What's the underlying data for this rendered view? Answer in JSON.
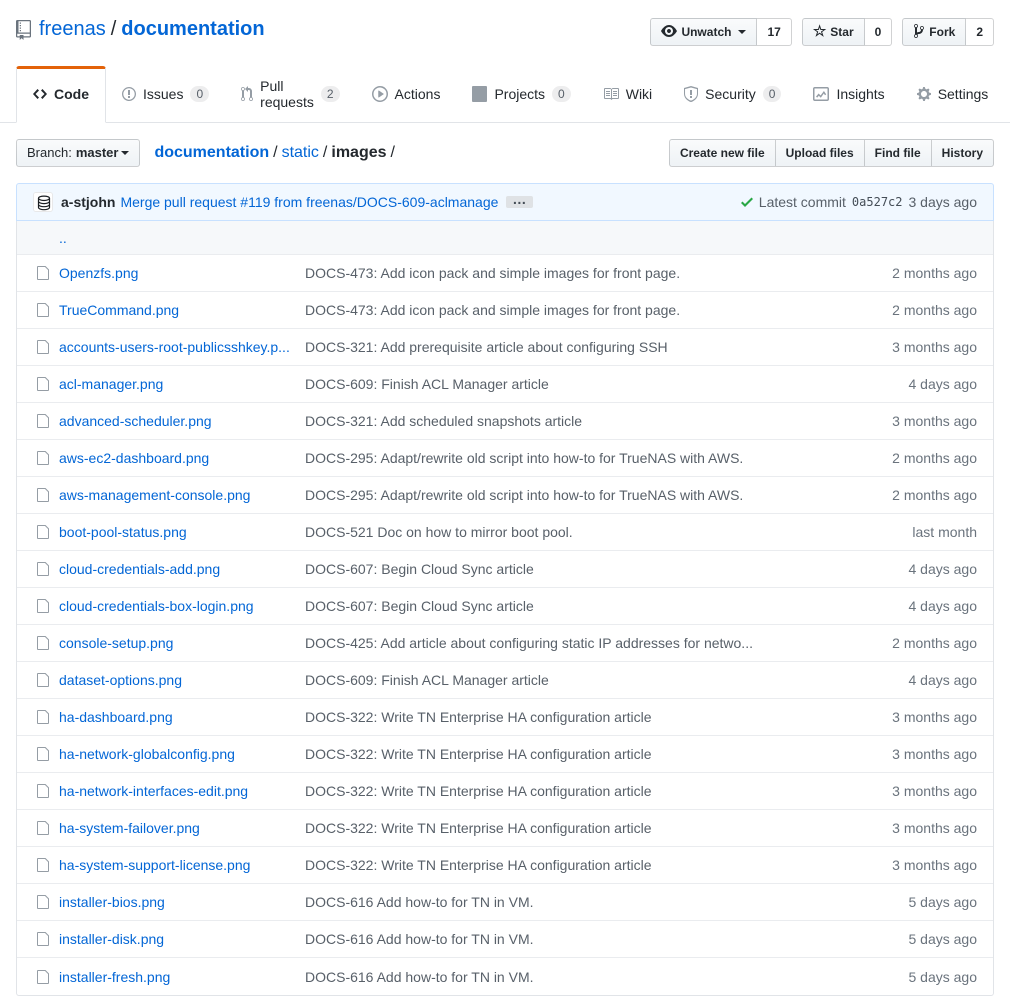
{
  "repo_header": {
    "owner": "freenas",
    "separator": "/",
    "name": "documentation"
  },
  "social": {
    "unwatch": {
      "label": "Unwatch",
      "count": "17",
      "icon": "eye-icon"
    },
    "star": {
      "label": "Star",
      "count": "0",
      "icon": "star-icon"
    },
    "fork": {
      "label": "Fork",
      "count": "2",
      "icon": "fork-icon"
    }
  },
  "tabs": [
    {
      "label": "Code",
      "icon": "code",
      "active": true
    },
    {
      "label": "Issues",
      "icon": "issue",
      "count": "0"
    },
    {
      "label": "Pull requests",
      "icon": "pull",
      "count": "2"
    },
    {
      "label": "Actions",
      "icon": "play"
    },
    {
      "label": "Projects",
      "icon": "project",
      "count": "0"
    },
    {
      "label": "Wiki",
      "icon": "book"
    },
    {
      "label": "Security",
      "icon": "shield",
      "count": "0"
    },
    {
      "label": "Insights",
      "icon": "graph"
    },
    {
      "label": "Settings",
      "icon": "gear"
    }
  ],
  "file_nav": {
    "branch_label": "Branch:",
    "branch_name": "master",
    "separator": "/",
    "breadcrumb": [
      {
        "label": "documentation",
        "type": "repo"
      },
      {
        "label": "static",
        "type": "dir"
      },
      {
        "label": "images",
        "type": "current"
      }
    ],
    "buttons": [
      "Create new file",
      "Upload files",
      "Find file",
      "History"
    ]
  },
  "commit_bar": {
    "author": "a-stjohn",
    "message_prefix": "Merge pull request ",
    "pr_link": "#119",
    "message_suffix": " from freenas/DOCS-609-aclmanage",
    "expander": "…",
    "latest_label": "Latest commit",
    "sha": "0a527c2",
    "age": "3 days ago"
  },
  "files": {
    "up": "..",
    "rows": [
      {
        "name": "Openzfs.png",
        "message": "DOCS-473: Add icon pack and simple images for front page.",
        "age": "2 months ago"
      },
      {
        "name": "TrueCommand.png",
        "message": "DOCS-473: Add icon pack and simple images for front page.",
        "age": "2 months ago"
      },
      {
        "name": "accounts-users-root-publicsshkey.p...",
        "message": "DOCS-321: Add prerequisite article about configuring SSH",
        "age": "3 months ago"
      },
      {
        "name": "acl-manager.png",
        "message": "DOCS-609: Finish ACL Manager article",
        "age": "4 days ago"
      },
      {
        "name": "advanced-scheduler.png",
        "message": "DOCS-321: Add scheduled snapshots article",
        "age": "3 months ago"
      },
      {
        "name": "aws-ec2-dashboard.png",
        "message": "DOCS-295: Adapt/rewrite old script into how-to for TrueNAS with AWS.",
        "age": "2 months ago"
      },
      {
        "name": "aws-management-console.png",
        "message": "DOCS-295: Adapt/rewrite old script into how-to for TrueNAS with AWS.",
        "age": "2 months ago"
      },
      {
        "name": "boot-pool-status.png",
        "message": "DOCS-521 Doc on how to mirror boot pool.",
        "age": "last month"
      },
      {
        "name": "cloud-credentials-add.png",
        "message": "DOCS-607: Begin Cloud Sync article",
        "age": "4 days ago"
      },
      {
        "name": "cloud-credentials-box-login.png",
        "message": "DOCS-607: Begin Cloud Sync article",
        "age": "4 days ago"
      },
      {
        "name": "console-setup.png",
        "message": "DOCS-425: Add article about configuring static IP addresses for netwo...",
        "age": "2 months ago"
      },
      {
        "name": "dataset-options.png",
        "message": "DOCS-609: Finish ACL Manager article",
        "age": "4 days ago"
      },
      {
        "name": "ha-dashboard.png",
        "message": "DOCS-322: Write TN Enterprise HA configuration article",
        "age": "3 months ago"
      },
      {
        "name": "ha-network-globalconfig.png",
        "message": "DOCS-322: Write TN Enterprise HA configuration article",
        "age": "3 months ago"
      },
      {
        "name": "ha-network-interfaces-edit.png",
        "message": "DOCS-322: Write TN Enterprise HA configuration article",
        "age": "3 months ago"
      },
      {
        "name": "ha-system-failover.png",
        "message": "DOCS-322: Write TN Enterprise HA configuration article",
        "age": "3 months ago"
      },
      {
        "name": "ha-system-support-license.png",
        "message": "DOCS-322: Write TN Enterprise HA configuration article",
        "age": "3 months ago"
      },
      {
        "name": "installer-bios.png",
        "message": "DOCS-616 Add how-to for TN in VM.",
        "age": "5 days ago"
      },
      {
        "name": "installer-disk.png",
        "message": "DOCS-616 Add how-to for TN in VM.",
        "age": "5 days ago"
      },
      {
        "name": "installer-fresh.png",
        "message": "DOCS-616 Add how-to for TN in VM.",
        "age": "5 days ago"
      }
    ]
  },
  "colors": {
    "link_blue": "#0366d6",
    "tab_active_border": "#e36209",
    "commit_bar_bg": "#f1f8ff",
    "commit_bar_border": "#c8e1ff",
    "check_green": "#28a745",
    "text_dark": "#24292e",
    "text_gray": "#586069",
    "age_gray": "#6a737d"
  }
}
